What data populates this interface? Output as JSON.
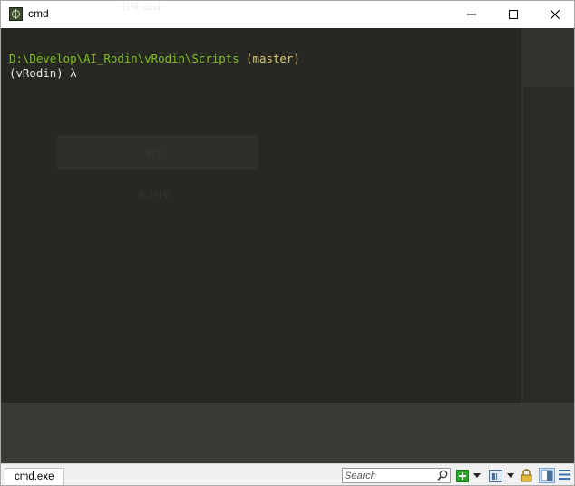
{
  "window": {
    "title": "cmd",
    "ghost_title": "선택: cmd"
  },
  "console": {
    "path": "D:\\Develop\\AI_Rodin\\vRodin\\Scripts",
    "branch": " (master)",
    "prompt": "(vRodin) λ",
    "ghost_button": "확인",
    "ghost_link": "로그아웃"
  },
  "statusbar": {
    "tab_label": "cmd.exe",
    "search_placeholder": "Search"
  },
  "colors": {
    "path": "#7fbf1e",
    "branch": "#d8c77a",
    "console_bg": "#272822",
    "new_tab_green": "#2ca52c",
    "lock_yellow": "#e0b83a"
  }
}
